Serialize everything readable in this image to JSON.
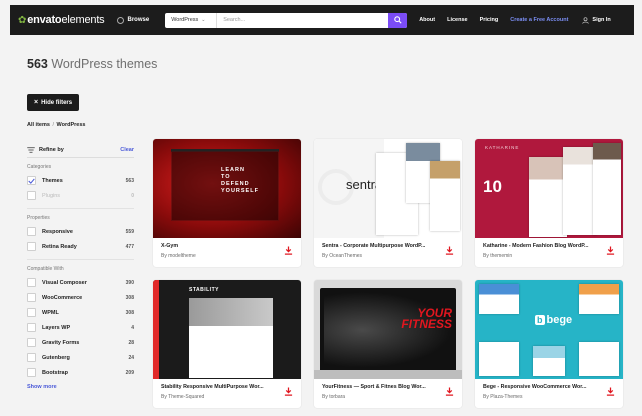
{
  "header": {
    "logo_text": "envato",
    "logo_light": "elements",
    "browse_label": "Browse",
    "search_category": "WordPress",
    "search_placeholder": "Search...",
    "nav": {
      "about": "About",
      "license": "License",
      "pricing": "Pricing",
      "create_account": "Create a Free Account",
      "sign_in": "Sign In"
    }
  },
  "page": {
    "count": "563",
    "heading_rest": "WordPress themes",
    "hide_filters_label": "Hide filters",
    "breadcrumb": {
      "root": "All items",
      "sep": "/",
      "current": "WordPress"
    }
  },
  "sidebar": {
    "refine_label": "Refine by",
    "clear_label": "Clear",
    "categories_title": "Categories",
    "categories": [
      {
        "name": "Themes",
        "count": "563",
        "checked": true
      },
      {
        "name": "Plugins",
        "count": "0",
        "checked": false
      }
    ],
    "properties_title": "Properties",
    "properties": [
      {
        "name": "Responsive",
        "count": "559"
      },
      {
        "name": "Retina Ready",
        "count": "477"
      }
    ],
    "compatible_title": "Compatible With",
    "compatible": [
      {
        "name": "Visual Composer",
        "count": "390"
      },
      {
        "name": "WooCommerce",
        "count": "308"
      },
      {
        "name": "WPML",
        "count": "308"
      },
      {
        "name": "Layers WP",
        "count": "4"
      },
      {
        "name": "Gravity Forms",
        "count": "28"
      },
      {
        "name": "Gutenberg",
        "count": "24"
      },
      {
        "name": "Bootstrap",
        "count": "209"
      }
    ],
    "show_more_label": "Show more"
  },
  "cards": [
    {
      "title": "X-Gym",
      "author": "By modeltheme",
      "thumb_text": [
        "LEARN",
        "TO",
        "DEFEND",
        "YOURSELF"
      ]
    },
    {
      "title": "Sentra - Corporate Multipurpose WordP...",
      "author": "By OceanThemes",
      "thumb_text": "sentra"
    },
    {
      "title": "Katharine - Modern Fashion Blog WordP...",
      "author": "By thememin",
      "thumb_text": "KATHARINE"
    },
    {
      "title": "Stability Responsive MultiPurpose Wor...",
      "author": "By Theme-Squared",
      "thumb_text": "STABILITY"
    },
    {
      "title": "YourFitness — Sport & Fitnes Blog Wor...",
      "author": "By torbara",
      "thumb_text": [
        "YOUR",
        "FITNESS"
      ]
    },
    {
      "title": "Bege - Responsive WooCommerce Wor...",
      "author": "By Plaza-Themes",
      "thumb_text": "bege"
    }
  ],
  "colors": {
    "accent": "#7b4cf6",
    "download": "#e0161f",
    "link": "#4a59d8",
    "topbar": "#1c1c1c"
  },
  "icons": {
    "browse": "grid-icon",
    "search": "search-icon",
    "sign_in": "user-icon",
    "download": "download-icon",
    "refine": "filter-lines-icon",
    "check": "check-icon"
  }
}
